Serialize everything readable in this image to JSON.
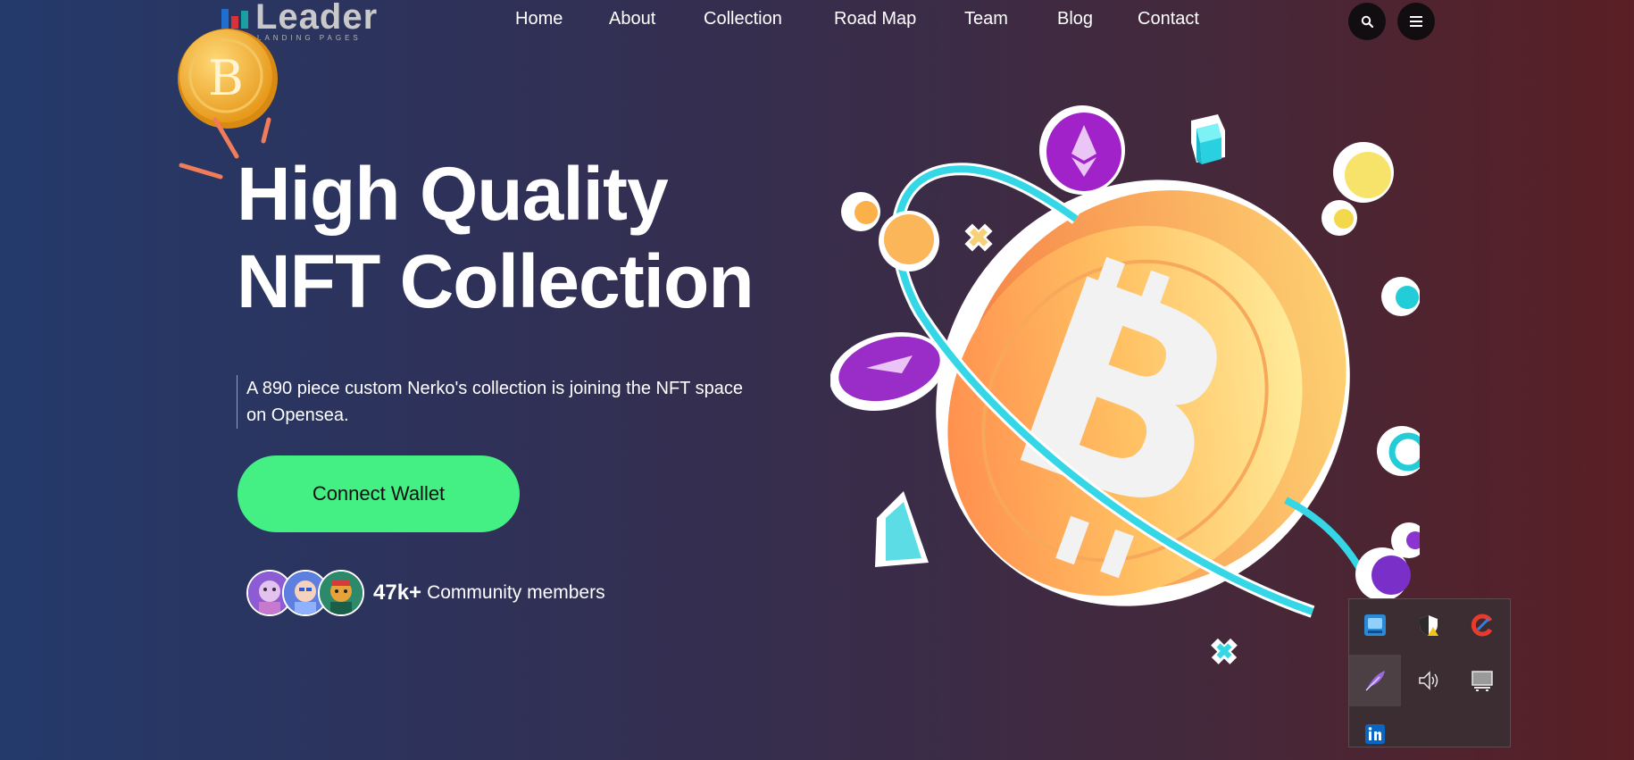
{
  "brand": {
    "name": "Leader",
    "tagline": "LANDING PAGES"
  },
  "nav": {
    "items": [
      {
        "label": "Home"
      },
      {
        "label": "About"
      },
      {
        "label": "Collection"
      },
      {
        "label": "Road Map"
      },
      {
        "label": "Team"
      },
      {
        "label": "Blog"
      },
      {
        "label": "Contact"
      }
    ],
    "icons": {
      "search": "search-icon",
      "menu": "menu-icon"
    }
  },
  "hero": {
    "title_line1": "High Quality",
    "title_line2": "NFT Collection",
    "description": "A 890 piece custom Nerko's collection is joining the NFT space on Opensea.",
    "cta_label": "Connect Wallet",
    "community_count": "47k+",
    "community_label": "Community members"
  },
  "tray": {
    "icons": [
      "intel-graphics-icon",
      "security-shield-icon",
      "ccleaner-icon",
      "feather-icon",
      "volume-icon",
      "network-monitor-icon",
      "linkedin-icon"
    ]
  },
  "colors": {
    "accent": "#44ef84",
    "coin": "#f8b84a",
    "ring": "#35d6e6"
  }
}
